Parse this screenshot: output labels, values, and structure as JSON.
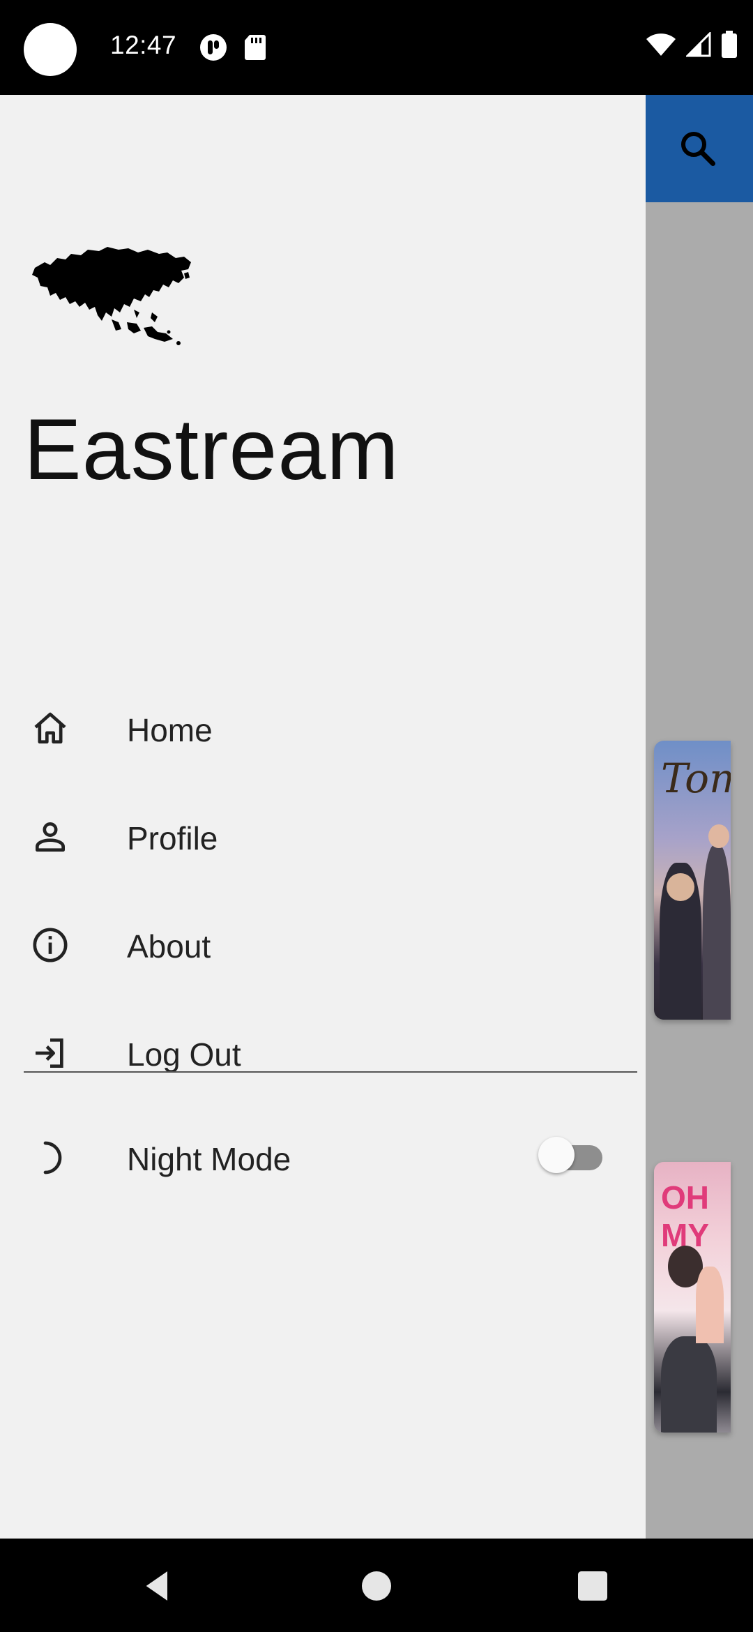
{
  "status_bar": {
    "time": "12:47",
    "icons": [
      "camera-dot",
      "notification-app-icon",
      "sd-card-icon",
      "wifi-icon",
      "signal-icon",
      "battery-icon"
    ]
  },
  "app": {
    "toolbar_color": "#1b5aa2",
    "posters": [
      {
        "title_fragment": "Tom"
      },
      {
        "title_fragment": "OH MY"
      }
    ]
  },
  "drawer": {
    "title": "Eastream",
    "logo": "asia-map-logo",
    "menu": [
      {
        "label": "Home",
        "icon": "home-icon"
      },
      {
        "label": "Profile",
        "icon": "person-icon"
      },
      {
        "label": "About",
        "icon": "info-icon"
      },
      {
        "label": "Log Out",
        "icon": "logout-icon"
      }
    ],
    "night_mode": {
      "label": "Night Mode",
      "icon": "moon-icon",
      "enabled": false
    }
  },
  "nav_bar": {
    "buttons": [
      "back-icon",
      "home-circle-icon",
      "recents-icon"
    ]
  }
}
